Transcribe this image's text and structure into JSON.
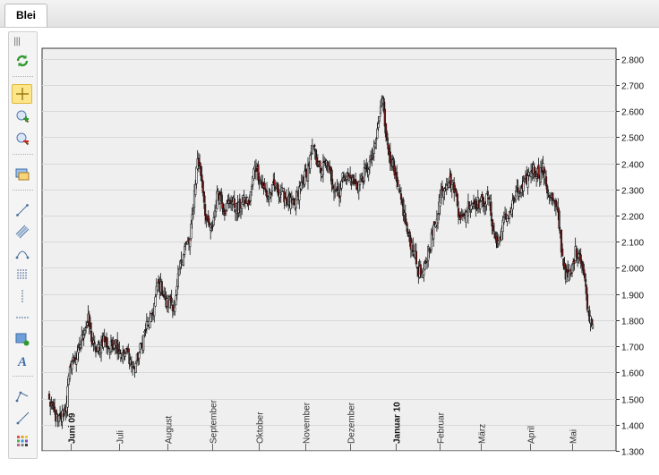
{
  "tabs": [
    {
      "label": "Blei"
    }
  ],
  "toolbar": {
    "tools": [
      {
        "name": "refresh-icon"
      },
      {
        "name": "crosshair-icon",
        "active": true
      },
      {
        "name": "zoom-in-icon"
      },
      {
        "name": "zoom-out-icon"
      },
      {
        "name": "export-icon"
      },
      {
        "name": "trend-line-icon"
      },
      {
        "name": "channel-icon"
      },
      {
        "name": "arc-icon"
      },
      {
        "name": "fibonacci-icon"
      },
      {
        "name": "vertical-line-icon"
      },
      {
        "name": "horizontal-line-icon"
      },
      {
        "name": "rectangle-icon"
      },
      {
        "name": "text-icon"
      },
      {
        "name": "path-icon"
      },
      {
        "name": "ray-icon"
      },
      {
        "name": "palette-icon"
      }
    ]
  },
  "chart_data": {
    "type": "candlestick",
    "title": "",
    "xlabel": "",
    "ylabel": "",
    "ylim": [
      1.3,
      2.84
    ],
    "y_ticks": [
      "2.800",
      "2.700",
      "2.600",
      "2.500",
      "2.400",
      "2.300",
      "2.200",
      "2.100",
      "2.000",
      "1.900",
      "1.800",
      "1.700",
      "1.600",
      "1.500",
      "1.400",
      "1.300"
    ],
    "x_ticks": [
      {
        "label": "Juni 09",
        "bold": true
      },
      {
        "label": "Juli",
        "bold": false
      },
      {
        "label": "August",
        "bold": false
      },
      {
        "label": "September",
        "bold": false
      },
      {
        "label": "Oktober",
        "bold": false
      },
      {
        "label": "November",
        "bold": false
      },
      {
        "label": "Dezember",
        "bold": false
      },
      {
        "label": "Januar 10",
        "bold": true
      },
      {
        "label": "Februar",
        "bold": false
      },
      {
        "label": "März",
        "bold": false
      },
      {
        "label": "April",
        "bold": false
      },
      {
        "label": "Mai",
        "bold": false
      }
    ],
    "grid": true,
    "up_color": "#ffffff",
    "down_color": "#8b1a1a",
    "series_path": [
      [
        0,
        1.49
      ],
      [
        8,
        1.41
      ],
      [
        15,
        1.46
      ],
      [
        20,
        1.64
      ],
      [
        26,
        1.66
      ],
      [
        32,
        1.76
      ],
      [
        36,
        1.8
      ],
      [
        40,
        1.71
      ],
      [
        44,
        1.68
      ],
      [
        50,
        1.73
      ],
      [
        56,
        1.69
      ],
      [
        60,
        1.72
      ],
      [
        64,
        1.69
      ],
      [
        68,
        1.66
      ],
      [
        72,
        1.68
      ],
      [
        78,
        1.61
      ],
      [
        82,
        1.66
      ],
      [
        86,
        1.72
      ],
      [
        90,
        1.78
      ],
      [
        94,
        1.8
      ],
      [
        98,
        1.88
      ],
      [
        100,
        1.94
      ],
      [
        104,
        1.92
      ],
      [
        108,
        1.86
      ],
      [
        112,
        1.88
      ],
      [
        116,
        1.84
      ],
      [
        120,
        1.99
      ],
      [
        125,
        2.08
      ],
      [
        130,
        2.1
      ],
      [
        134,
        2.29
      ],
      [
        137,
        2.42
      ],
      [
        141,
        2.34
      ],
      [
        145,
        2.18
      ],
      [
        150,
        2.14
      ],
      [
        156,
        2.3
      ],
      [
        162,
        2.22
      ],
      [
        168,
        2.26
      ],
      [
        174,
        2.22
      ],
      [
        180,
        2.26
      ],
      [
        185,
        2.25
      ],
      [
        190,
        2.4
      ],
      [
        196,
        2.32
      ],
      [
        202,
        2.27
      ],
      [
        208,
        2.31
      ],
      [
        214,
        2.29
      ],
      [
        220,
        2.26
      ],
      [
        226,
        2.23
      ],
      [
        232,
        2.31
      ],
      [
        238,
        2.37
      ],
      [
        244,
        2.46
      ],
      [
        250,
        2.37
      ],
      [
        256,
        2.4
      ],
      [
        262,
        2.32
      ],
      [
        268,
        2.29
      ],
      [
        272,
        2.36
      ],
      [
        278,
        2.34
      ],
      [
        284,
        2.31
      ],
      [
        290,
        2.35
      ],
      [
        296,
        2.4
      ],
      [
        300,
        2.44
      ],
      [
        304,
        2.55
      ],
      [
        308,
        2.66
      ],
      [
        312,
        2.47
      ],
      [
        316,
        2.41
      ],
      [
        320,
        2.33
      ],
      [
        326,
        2.24
      ],
      [
        332,
        2.11
      ],
      [
        336,
        2.08
      ],
      [
        340,
        2.0
      ],
      [
        345,
        1.96
      ],
      [
        350,
        2.07
      ],
      [
        356,
        2.16
      ],
      [
        362,
        2.29
      ],
      [
        368,
        2.34
      ],
      [
        374,
        2.31
      ],
      [
        378,
        2.22
      ],
      [
        382,
        2.18
      ],
      [
        388,
        2.25
      ],
      [
        394,
        2.25
      ],
      [
        400,
        2.25
      ],
      [
        406,
        2.27
      ],
      [
        410,
        2.15
      ],
      [
        414,
        2.08
      ],
      [
        420,
        2.18
      ],
      [
        426,
        2.22
      ],
      [
        432,
        2.29
      ],
      [
        436,
        2.29
      ],
      [
        440,
        2.33
      ],
      [
        446,
        2.38
      ],
      [
        452,
        2.36
      ],
      [
        456,
        2.38
      ],
      [
        460,
        2.3
      ],
      [
        465,
        2.26
      ],
      [
        470,
        2.2
      ],
      [
        474,
        2.04
      ],
      [
        478,
        1.96
      ],
      [
        482,
        1.98
      ],
      [
        486,
        2.06
      ],
      [
        490,
        2.06
      ],
      [
        494,
        1.97
      ],
      [
        498,
        1.83
      ],
      [
        502,
        1.79
      ]
    ]
  }
}
